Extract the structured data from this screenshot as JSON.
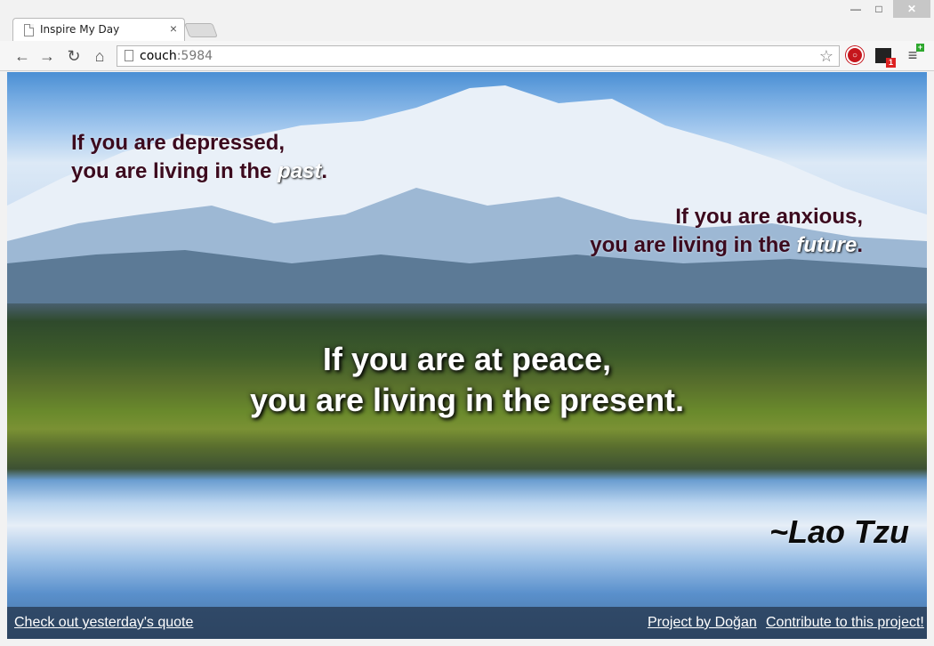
{
  "window": {
    "tab_title": "Inspire My Day",
    "tab_close": "×",
    "minimize": "—",
    "maximize": "□",
    "close": "✕"
  },
  "toolbar": {
    "back": "←",
    "forward": "→",
    "reload": "↻",
    "home": "⌂",
    "url_host": "couch",
    "url_port": ":5984",
    "star": "☆",
    "ext_badge": "1",
    "menu": "≡",
    "menu_plus": "+"
  },
  "quotes": {
    "past_line1": "If you are depressed,",
    "past_line2_prefix": "you are living in the ",
    "past_word": "past",
    "past_suffix": ".",
    "future_line1": "If you are anxious,",
    "future_line2_prefix": "you are living in the ",
    "future_word": "future",
    "future_suffix": ".",
    "present_line1": "If you are at peace,",
    "present_line2": "you are living in the present.",
    "author": "~Lao Tzu"
  },
  "footer": {
    "yesterday": "Check out yesterday's quote",
    "project_by": "Project by Doğan",
    "contribute": "Contribute to this project!"
  },
  "colors": {
    "quote_dark": "#3c0a1e",
    "footer_bg": "#283c55"
  }
}
